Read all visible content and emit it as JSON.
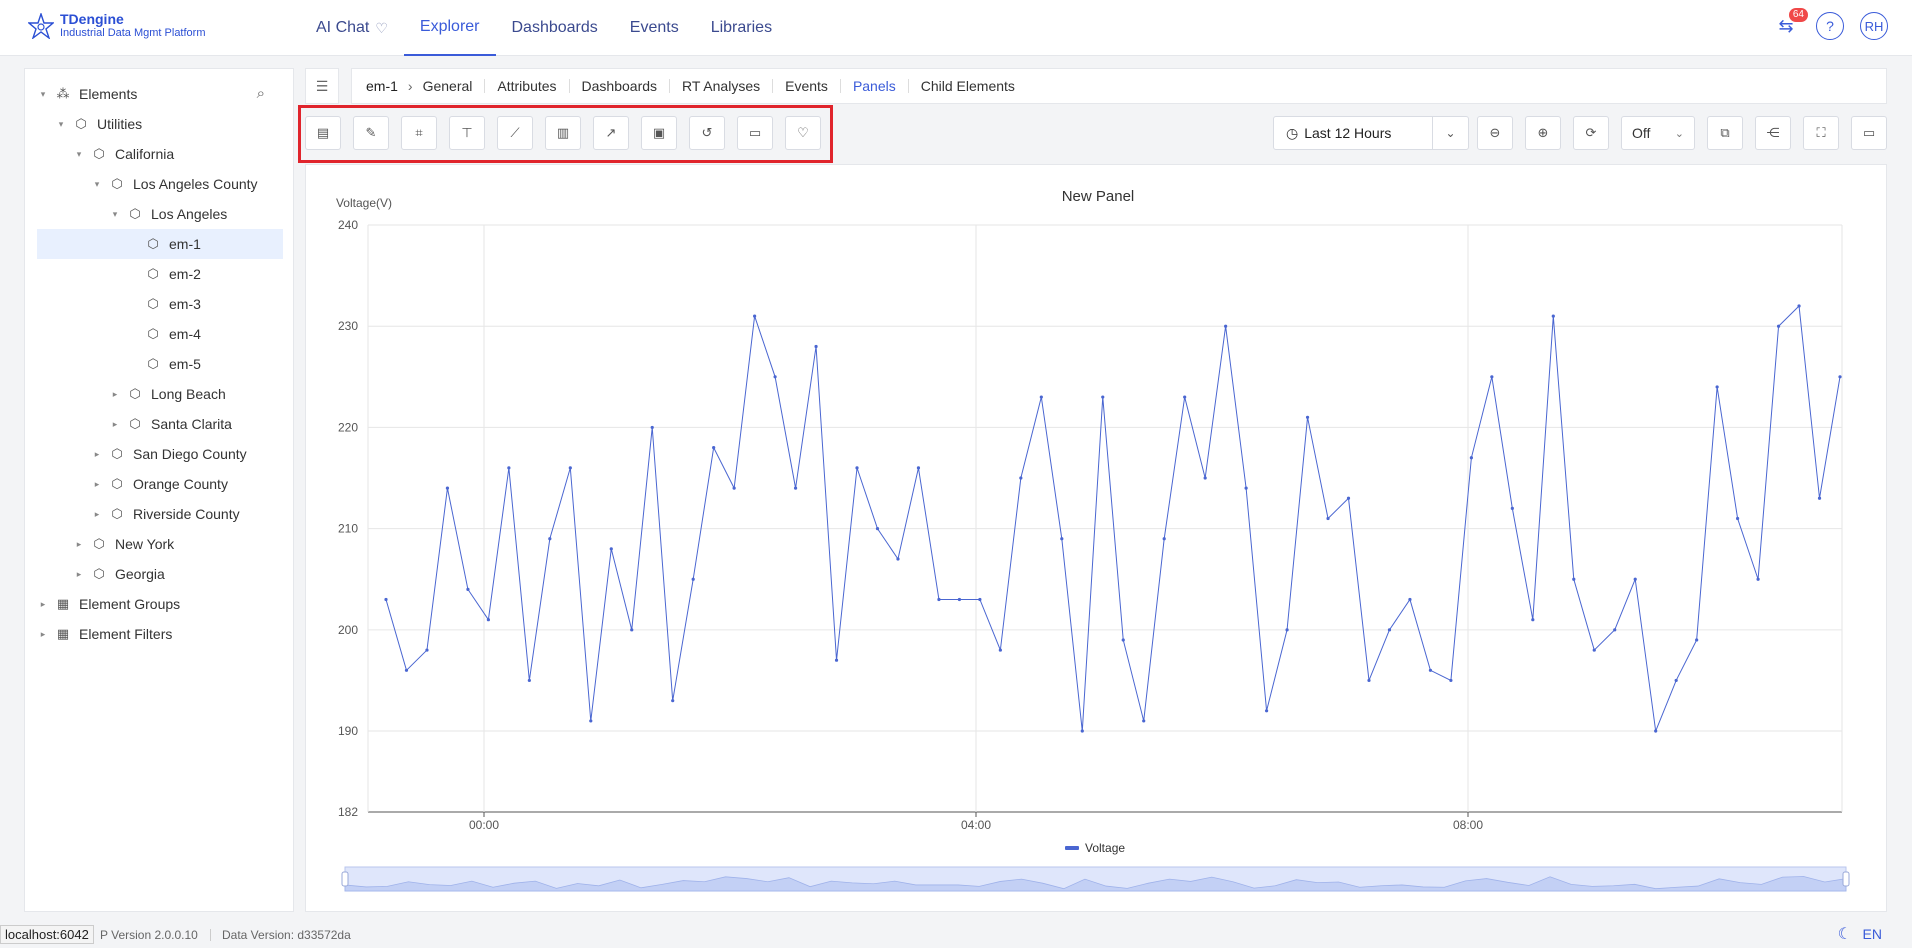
{
  "app": {
    "name": "TDengine",
    "subtitle": "Industrial Data Mgmt Platform"
  },
  "nav": {
    "items": [
      {
        "label": "AI Chat",
        "active": false
      },
      {
        "label": "Explorer",
        "active": true
      },
      {
        "label": "Dashboards",
        "active": false
      },
      {
        "label": "Events",
        "active": false
      },
      {
        "label": "Libraries",
        "active": false
      }
    ],
    "notification_count": "64",
    "help_label": "?",
    "user_initials": "RH"
  },
  "sidebar": {
    "items": [
      {
        "label": "Elements",
        "icon": "elements-icon",
        "caret": "down"
      },
      {
        "label": "Utilities",
        "icon": "cube-icon",
        "caret": "down"
      },
      {
        "label": "California",
        "icon": "cube-icon",
        "caret": "down"
      },
      {
        "label": "Los Angeles County",
        "icon": "cube-icon",
        "caret": "down"
      },
      {
        "label": "Los Angeles",
        "icon": "cube-icon",
        "caret": "down"
      },
      {
        "label": "em-1",
        "icon": "cube-icon",
        "caret": "none",
        "selected": true
      },
      {
        "label": "em-2",
        "icon": "cube-icon",
        "caret": "none"
      },
      {
        "label": "em-3",
        "icon": "cube-icon",
        "caret": "none"
      },
      {
        "label": "em-4",
        "icon": "cube-icon",
        "caret": "none"
      },
      {
        "label": "em-5",
        "icon": "cube-icon",
        "caret": "none"
      },
      {
        "label": "Long Beach",
        "icon": "cube-icon",
        "caret": "right"
      },
      {
        "label": "Santa Clarita",
        "icon": "cube-icon",
        "caret": "right"
      },
      {
        "label": "San Diego County",
        "icon": "cube-icon",
        "caret": "right"
      },
      {
        "label": "Orange County",
        "icon": "cube-icon",
        "caret": "right"
      },
      {
        "label": "Riverside County",
        "icon": "cube-icon",
        "caret": "right"
      },
      {
        "label": "New York",
        "icon": "cube-icon",
        "caret": "right"
      },
      {
        "label": "Georgia",
        "icon": "cube-icon",
        "caret": "right"
      },
      {
        "label": "Element Groups",
        "icon": "element-groups-icon",
        "caret": "right"
      },
      {
        "label": "Element Filters",
        "icon": "element-filters-icon",
        "caret": "right"
      }
    ]
  },
  "breadcrumb": {
    "root": "em-1",
    "tabs": [
      "General",
      "Attributes",
      "Dashboards",
      "RT Analyses",
      "Events",
      "Panels",
      "Child Elements"
    ],
    "active_tab": "Panels"
  },
  "toolbar": {
    "tools": [
      "panel-list-icon",
      "edit-icon",
      "crop-icon",
      "align-icon",
      "line-chart-icon",
      "bar-line-chart-icon",
      "trend-chart-icon",
      "image-chart-icon",
      "history-icon",
      "comment-icon",
      "trophy-icon"
    ],
    "time_range": "Last 12 Hours",
    "refresh_value": "Off"
  },
  "chart_data": {
    "type": "line",
    "title": "New Panel",
    "ylabel": "Voltage(V)",
    "ylim": [
      182,
      240
    ],
    "yticks": [
      "240",
      "230",
      "220",
      "210",
      "200",
      "190",
      "182"
    ],
    "xticks": [
      "00:00",
      "04:00",
      "08:00"
    ],
    "series": [
      {
        "name": "Voltage",
        "color": "#4a66d1",
        "values": [
          203,
          196,
          198,
          214,
          204,
          201,
          216,
          195,
          209,
          216,
          191,
          208,
          200,
          220,
          193,
          205,
          218,
          214,
          231,
          225,
          214,
          228,
          197,
          216,
          210,
          207,
          216,
          203,
          203,
          203,
          198,
          215,
          223,
          209,
          190,
          223,
          199,
          191,
          209,
          223,
          215,
          230,
          214,
          192,
          200,
          221,
          211,
          213,
          195,
          200,
          203,
          196,
          195,
          217,
          225,
          212,
          201,
          231,
          205,
          198,
          200,
          205,
          190,
          195,
          199,
          224,
          211,
          205,
          230,
          232,
          213,
          225
        ]
      }
    ]
  },
  "footer": {
    "host": "localhost:6042",
    "version": "P Version 2.0.0.10",
    "data_version": "Data Version:  d33572da",
    "lang": "EN"
  }
}
